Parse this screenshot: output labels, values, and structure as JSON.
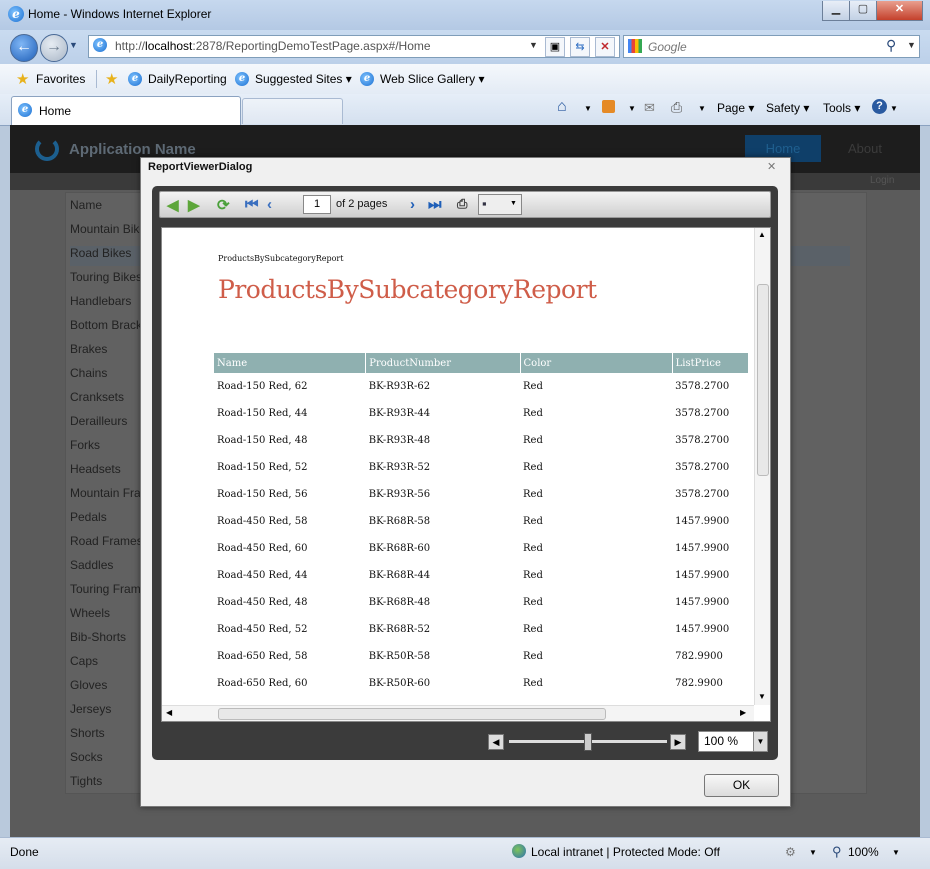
{
  "window": {
    "title": "Home - Windows Internet Explorer",
    "min": "▁",
    "max": "▢",
    "close": "✕"
  },
  "address": {
    "url_prefix": "http://",
    "url_host": "localhost",
    "url_rest": ":2878/ReportingDemoTestPage.aspx#/Home",
    "search_placeholder": "Google"
  },
  "favorites": {
    "label": "Favorites",
    "items": [
      "DailyReporting",
      "Suggested Sites ▾",
      "Web Slice Gallery ▾"
    ]
  },
  "tab": {
    "label": "Home"
  },
  "commands": [
    "Page ▾",
    "Safety ▾",
    "Tools ▾"
  ],
  "app": {
    "name": "Application Name",
    "nav_home": "Home",
    "nav_about": "About",
    "login": "Login"
  },
  "subcategories": {
    "header": "Name",
    "items": [
      "Mountain Bikes",
      "Road Bikes",
      "Touring Bikes",
      "Handlebars",
      "Bottom Brackets",
      "Brakes",
      "Chains",
      "Cranksets",
      "Derailleurs",
      "Forks",
      "Headsets",
      "Mountain Frames",
      "Pedals",
      "Road Frames",
      "Saddles",
      "Touring Frames",
      "Wheels",
      "Bib-Shorts",
      "Caps",
      "Gloves",
      "Jerseys",
      "Shorts",
      "Socks",
      "Tights"
    ],
    "selected_index": 1
  },
  "dialog": {
    "title": "ReportViewerDialog",
    "toolbar": {
      "page_value": "1",
      "page_of": "of 2 pages"
    },
    "report": {
      "small_title": "ProductsBySubcategoryReport",
      "title": "ProductsBySubcategoryReport",
      "columns": [
        "Name",
        "ProductNumber",
        "Color",
        "ListPrice"
      ],
      "rows": [
        [
          "Road-150 Red, 62",
          "BK-R93R-62",
          "Red",
          "3578.2700"
        ],
        [
          "Road-150 Red, 44",
          "BK-R93R-44",
          "Red",
          "3578.2700"
        ],
        [
          "Road-150 Red, 48",
          "BK-R93R-48",
          "Red",
          "3578.2700"
        ],
        [
          "Road-150 Red, 52",
          "BK-R93R-52",
          "Red",
          "3578.2700"
        ],
        [
          "Road-150 Red, 56",
          "BK-R93R-56",
          "Red",
          "3578.2700"
        ],
        [
          "Road-450 Red, 58",
          "BK-R68R-58",
          "Red",
          "1457.9900"
        ],
        [
          "Road-450 Red, 60",
          "BK-R68R-60",
          "Red",
          "1457.9900"
        ],
        [
          "Road-450 Red, 44",
          "BK-R68R-44",
          "Red",
          "1457.9900"
        ],
        [
          "Road-450 Red, 48",
          "BK-R68R-48",
          "Red",
          "1457.9900"
        ],
        [
          "Road-450 Red, 52",
          "BK-R68R-52",
          "Red",
          "1457.9900"
        ],
        [
          "Road-650 Red, 58",
          "BK-R50R-58",
          "Red",
          "782.9900"
        ],
        [
          "Road-650 Red, 60",
          "BK-R50R-60",
          "Red",
          "782.9900"
        ]
      ]
    },
    "zoom": "100 %",
    "ok": "OK"
  },
  "status": {
    "left": "Done",
    "zone": "Local intranet | Protected Mode: Off",
    "zoom": "100%"
  },
  "colors": {
    "report_title": "#cf5d49",
    "table_header": "#8fb0b0",
    "nav_selected": "#0f3f69"
  }
}
